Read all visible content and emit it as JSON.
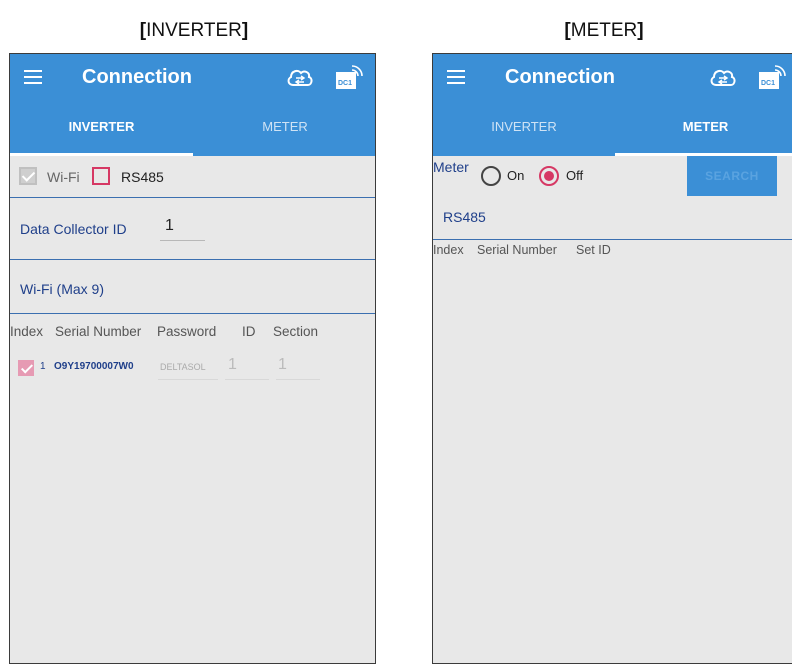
{
  "captions": {
    "left_open": "[",
    "left_text": "INVERTER",
    "left_close": "]",
    "right_open": "[",
    "right_text": "METER",
    "right_close": "]"
  },
  "app": {
    "title": "Connection",
    "tabs": [
      "INVERTER",
      "METER"
    ]
  },
  "inverter": {
    "wifi_label": "Wi-Fi",
    "rs485_label": "RS485",
    "data_collector_label": "Data Collector ID",
    "data_collector_value": "1",
    "wifi_section_label": "Wi-Fi (Max 9)",
    "columns": [
      "Index",
      "Serial Number",
      "Password",
      "ID",
      "Section"
    ],
    "rows": [
      {
        "index": "1",
        "serial": "O9Y19700007W0",
        "password": "DELTASOL",
        "id": "1",
        "section": "1"
      }
    ]
  },
  "meter": {
    "meter_label": "Meter",
    "on_label": "On",
    "off_label": "Off",
    "search_label": "SEARCH",
    "rs485_label": "RS485",
    "columns": [
      "Index",
      "Serial Number",
      "Set ID"
    ]
  },
  "colors": {
    "appbar": "#3b8fd6",
    "accent_pink": "#d63864",
    "divider": "#3b6fb0"
  }
}
